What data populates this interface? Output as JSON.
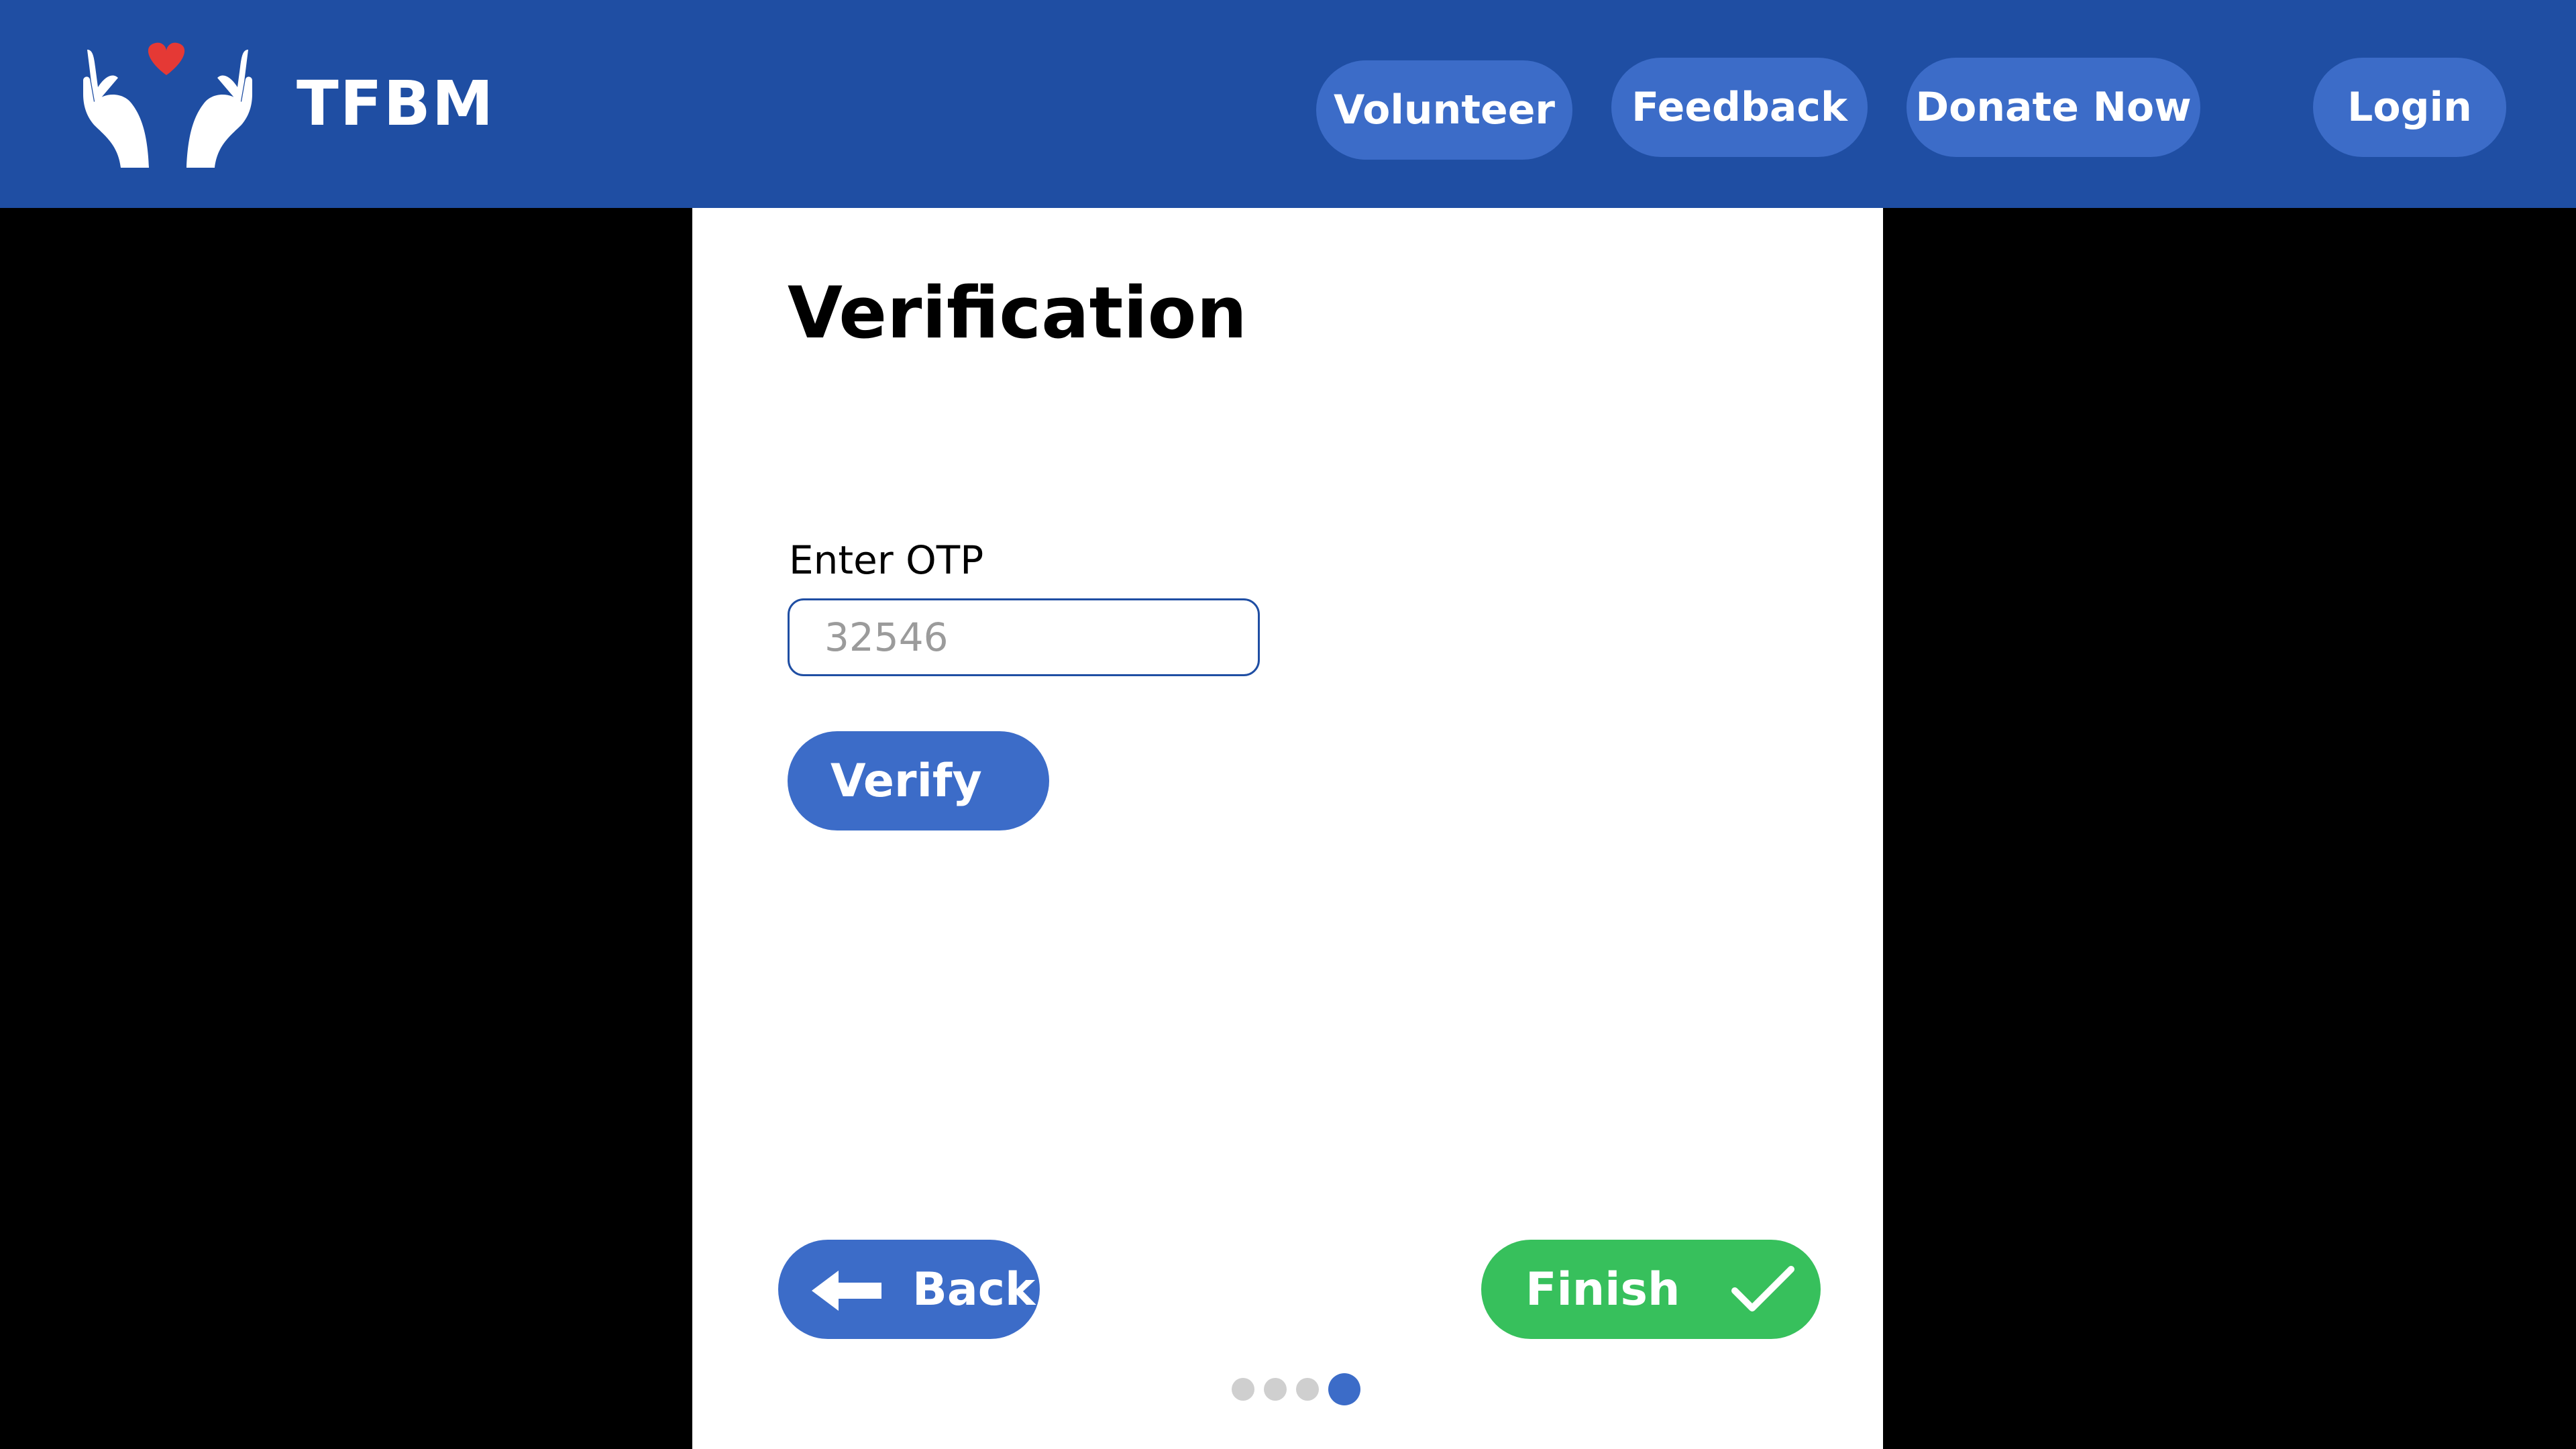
{
  "header": {
    "brand": "TFBM",
    "nav": [
      {
        "label": "Volunteer"
      },
      {
        "label": "Feedback"
      },
      {
        "label": "Donate Now"
      },
      {
        "label": "Login"
      }
    ]
  },
  "main": {
    "title": "Verification",
    "otp_label": "Enter OTP",
    "otp_placeholder": "32546",
    "otp_value": "",
    "verify_label": "Verify",
    "back_label": "Back",
    "finish_label": "Finish"
  },
  "steps": {
    "total": 4,
    "current": 4
  },
  "colors": {
    "header": "#1f4ea3",
    "button": "#3c6cc8",
    "finish": "#37c05c",
    "heart": "#e53935"
  },
  "icons": {
    "logo": "hands-heart-icon",
    "back": "arrow-left-icon",
    "finish": "checkmark-icon"
  }
}
